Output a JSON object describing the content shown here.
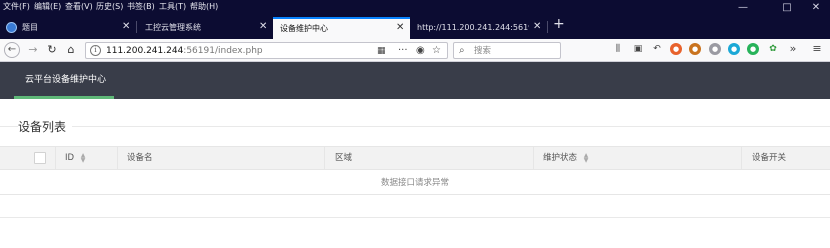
{
  "menubar": {
    "items": [
      "文件(F)",
      "编辑(E)",
      "查看(V)",
      "历史(S)",
      "书签(B)",
      "工具(T)",
      "帮助(H)"
    ]
  },
  "window_controls": {
    "minimize": "—",
    "maximize": "□",
    "close": "✕"
  },
  "tabs": [
    {
      "title": "题目",
      "icon": "globe-icon",
      "active": false
    },
    {
      "title": "工控云管理系统",
      "active": false
    },
    {
      "title": "设备维护中心",
      "active": true
    },
    {
      "title": "http://111.200.241.244:56191/",
      "active": false
    }
  ],
  "new_tab": "+",
  "address": {
    "host": "111.200.241.244",
    "rest": ":56191/index.php"
  },
  "search": {
    "placeholder": "搜索"
  },
  "toolbar_icons": [
    "library-icon",
    "sidebar-icon",
    "history-back-icon",
    "extension-orange-icon",
    "cookie-icon",
    "extension-gray-icon",
    "extension-cyan-icon",
    "extension-green-icon",
    "extension-leaf-icon",
    "overflow-icon",
    "menu-icon"
  ],
  "colors": {
    "chrome_bg": "#0c0c32",
    "header_bg": "#393d49",
    "accent_green": "#5fb878",
    "tab_accent": "#0a84ff"
  },
  "app": {
    "nav_item": "云平台设备维护中心"
  },
  "page": {
    "title": "设备列表"
  },
  "table": {
    "columns": [
      {
        "label": "ID",
        "sortable": true
      },
      {
        "label": "设备名",
        "sortable": false
      },
      {
        "label": "区域",
        "sortable": false
      },
      {
        "label": "维护状态",
        "sortable": true
      },
      {
        "label": "设备开关",
        "sortable": false
      }
    ],
    "empty_message": "数据接口请求异常"
  }
}
